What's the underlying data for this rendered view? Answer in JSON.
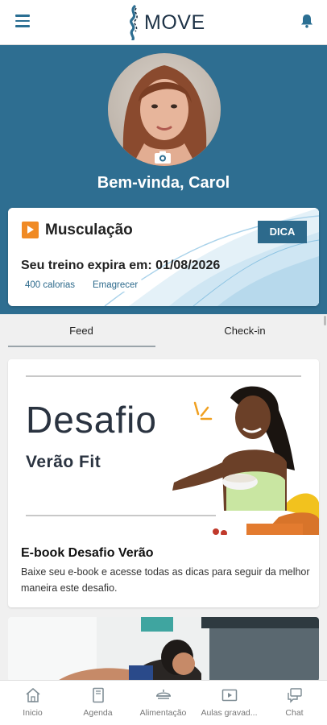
{
  "app": {
    "brand": "MOVE"
  },
  "profile": {
    "welcome": "Bem-vinda, Carol"
  },
  "workout": {
    "title": "Musculação",
    "tip_button": "DICA",
    "expire_text": "Seu treino expira em: 01/08/2026",
    "tags": [
      "400 calorias",
      "Emagrecer"
    ]
  },
  "tabs": [
    {
      "label": "Feed",
      "active": true
    },
    {
      "label": "Check-in",
      "active": false
    }
  ],
  "feed": [
    {
      "banner_title": "Desafio",
      "banner_subtitle": "Verão Fit",
      "title": "E-book Desafio Verão",
      "body": "Baixe seu e-book e acesse todas as dicas para seguir da melhor maneira este desafio."
    }
  ],
  "bottom_nav": [
    {
      "label": "Inicio",
      "icon": "home-icon"
    },
    {
      "label": "Agenda",
      "icon": "calendar-book-icon"
    },
    {
      "label": "Alimentação",
      "icon": "food-icon"
    },
    {
      "label": "Aulas gravad...",
      "icon": "video-icon"
    },
    {
      "label": "Chat",
      "icon": "chat-icon"
    }
  ],
  "colors": {
    "primary": "#2e6e91",
    "accent_orange": "#f08a24",
    "dark_text": "#1d3246"
  }
}
